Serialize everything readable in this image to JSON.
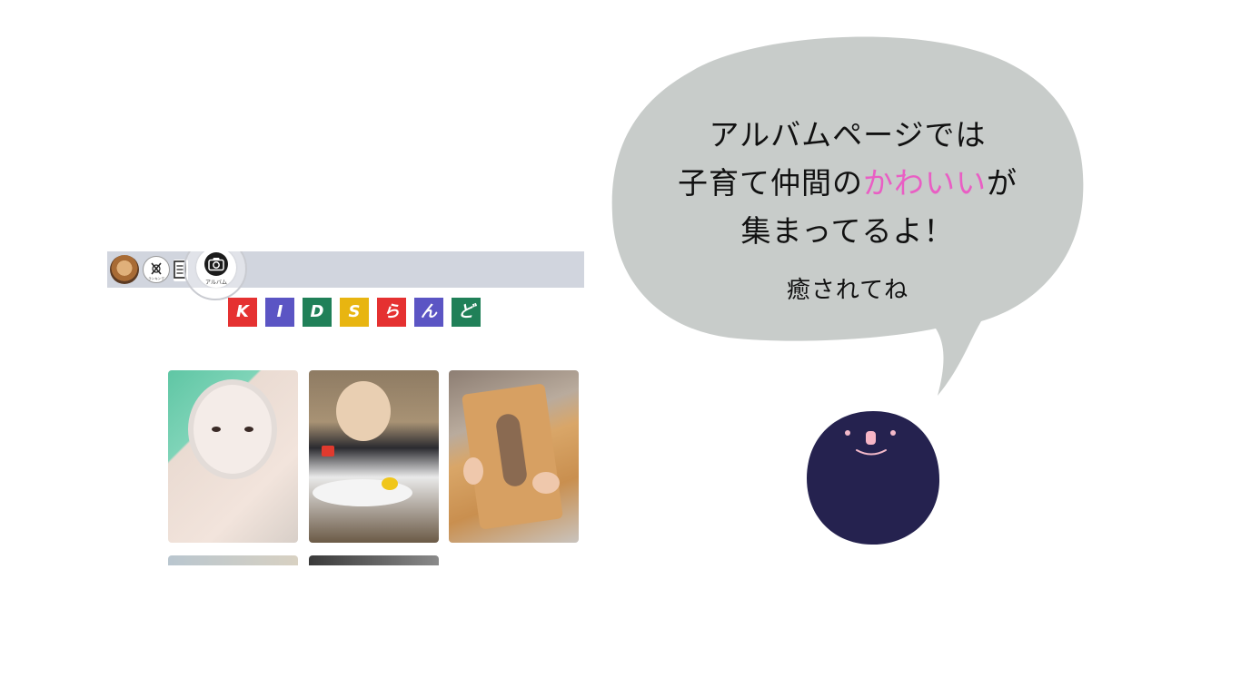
{
  "nav": {
    "ranking_label": "ランキング",
    "album_label": "アルバム"
  },
  "logo": {
    "tiles": [
      {
        "char": "K",
        "color": "#e53131"
      },
      {
        "char": "I",
        "color": "#5b55c4"
      },
      {
        "char": "D",
        "color": "#208058"
      },
      {
        "char": "S",
        "color": "#e8b511"
      },
      {
        "char": "ら",
        "color": "#e53131"
      },
      {
        "char": "ん",
        "color": "#5b55c4"
      },
      {
        "char": "ど",
        "color": "#208058"
      }
    ]
  },
  "bubble": {
    "line1": "アルバムページでは",
    "line2_before": "子育て仲間の",
    "line2_highlight": "かわいい",
    "line2_after": "が",
    "line3": "集まってるよ！",
    "subline": "癒されてね",
    "fill_color": "#c8ccca",
    "highlight_color": "#e95ec4"
  },
  "character": {
    "body_color": "#25224f"
  }
}
